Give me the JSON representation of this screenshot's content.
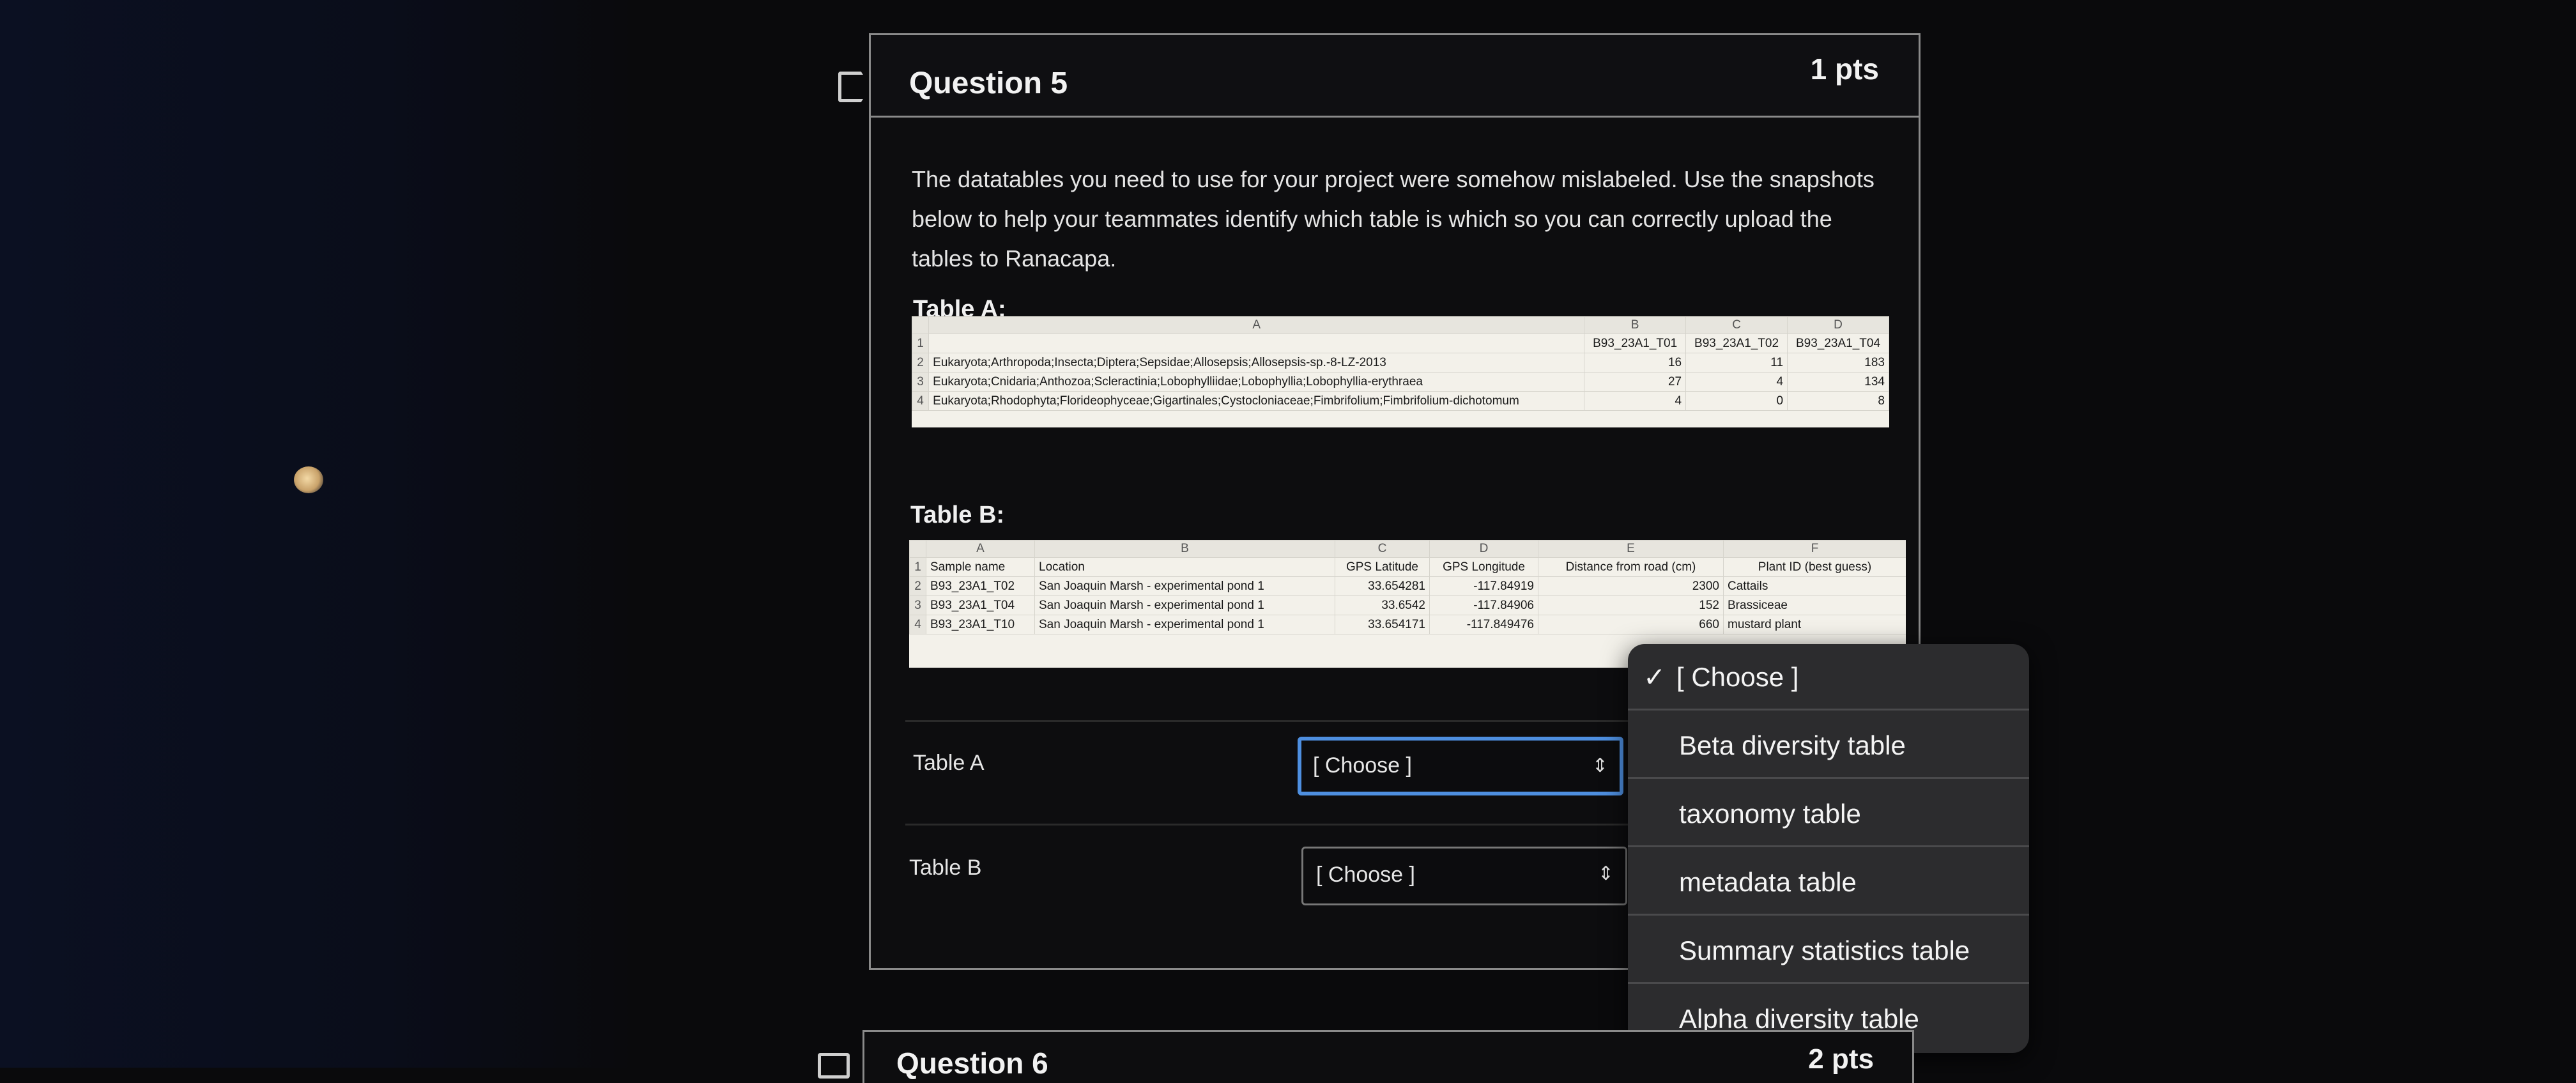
{
  "question": {
    "title": "Question 5",
    "points": "1 pts",
    "prompt": "The datatables you need to use for your project were somehow mislabeled. Use the snapshots below to help your teammates identify which table is which so you can correctly upload the tables to Ranacapa."
  },
  "table_a": {
    "label": "Table A:",
    "col_letters": [
      "A",
      "B",
      "C",
      "D"
    ],
    "header_row": [
      "",
      "B93_23A1_T01",
      "B93_23A1_T02",
      "B93_23A1_T04"
    ],
    "rows": [
      [
        "Eukaryota;Arthropoda;Insecta;Diptera;Sepsidae;Allosepsis;Allosepsis-sp.-8-LZ-2013",
        "16",
        "11",
        "183"
      ],
      [
        "Eukaryota;Cnidaria;Anthozoa;Scleractinia;Lobophylliidae;Lobophyllia;Lobophyllia-erythraea",
        "27",
        "4",
        "134"
      ],
      [
        "Eukaryota;Rhodophyta;Florideophyceae;Gigartinales;Cystocloniaceae;Fimbrifolium;Fimbrifolium-dichotomum",
        "4",
        "0",
        "8"
      ]
    ],
    "row_numbers": [
      "1",
      "2",
      "3",
      "4"
    ]
  },
  "table_b": {
    "label": "Table B:",
    "col_letters": [
      "A",
      "B",
      "C",
      "D",
      "E",
      "F"
    ],
    "header_row": [
      "Sample name",
      "Location",
      "GPS Latitude",
      "GPS Longitude",
      "Distance from road (cm)",
      "Plant ID (best guess)"
    ],
    "rows": [
      [
        "B93_23A1_T02",
        "San Joaquin Marsh - experimental pond 1",
        "33.654281",
        "-117.84919",
        "2300",
        "Cattails"
      ],
      [
        "B93_23A1_T04",
        "San Joaquin Marsh - experimental pond 1",
        "33.6542",
        "-117.84906",
        "152",
        "Brassiceae"
      ],
      [
        "B93_23A1_T10",
        "San Joaquin Marsh - experimental pond 1",
        "33.654171",
        "-117.849476",
        "660",
        "mustard plant"
      ]
    ],
    "row_numbers": [
      "1",
      "2",
      "3",
      "4"
    ]
  },
  "answers": {
    "table_a_label": "Table A",
    "table_a_value": "[ Choose ]",
    "table_b_label": "Table B",
    "table_b_value": "[ Choose ]"
  },
  "dropdown": {
    "check": "✓",
    "options": [
      "[ Choose ]",
      "Beta diversity table",
      "taxonomy table",
      "metadata table",
      "Summary statistics table",
      "Alpha diversity table"
    ]
  },
  "next_question": {
    "title": "Question 6",
    "points": "2 pts"
  },
  "icons": {
    "bookmark": "bookmark-icon",
    "select_arrows": "updown-arrows-icon",
    "check": "checkmark-icon"
  },
  "colors": {
    "focus_border": "#4e8fe0",
    "dropdown_bg": "#2c2c2e",
    "sheet_bg": "#f3f1ea"
  }
}
